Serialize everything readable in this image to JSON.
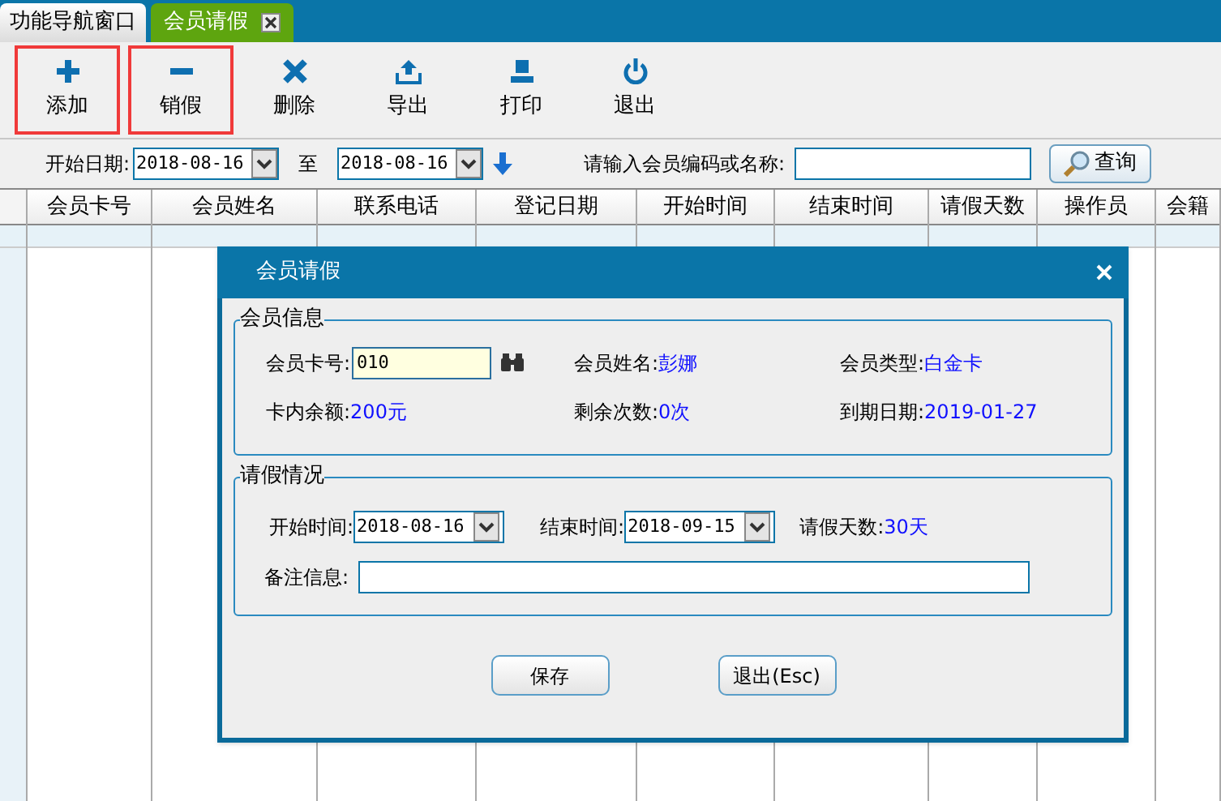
{
  "tabs": [
    {
      "label": "功能导航窗口",
      "selected": false
    },
    {
      "label": "会员请假",
      "selected": true
    }
  ],
  "toolbar": [
    {
      "label": "添加",
      "kind": "add",
      "highlighted": true
    },
    {
      "label": "销假",
      "kind": "cancel",
      "highlighted": true
    },
    {
      "label": "删除",
      "kind": "delete",
      "highlighted": false
    },
    {
      "label": "导出",
      "kind": "export",
      "highlighted": false
    },
    {
      "label": "打印",
      "kind": "print",
      "highlighted": false
    },
    {
      "label": "退出",
      "kind": "exit",
      "highlighted": false
    }
  ],
  "filter": {
    "start_label": "开始日期:",
    "start_value": "2018-08-16",
    "to_label": "至",
    "end_value": "2018-08-16",
    "search_label": "请输入会员编码或名称:",
    "search_button": "查询"
  },
  "table": {
    "columns": [
      "会员卡号",
      "会员姓名",
      "联系电话",
      "登记日期",
      "开始时间",
      "结束时间",
      "请假天数",
      "操作员",
      "会籍"
    ]
  },
  "dialog": {
    "title": "会员请假",
    "member_info": {
      "legend": "会员信息",
      "card_label": "会员卡号:",
      "card_value": "010",
      "fields": [
        {
          "label": "会员姓名:",
          "value": "彭娜"
        },
        {
          "label": "会员类型:",
          "value": "白金卡"
        },
        {
          "label": "卡内余额:",
          "value": "200元"
        },
        {
          "label": "剩余次数:",
          "value": "0次"
        },
        {
          "label": "到期日期:",
          "value": "2019-01-27"
        }
      ]
    },
    "leave_info": {
      "legend": "请假情况",
      "start_label": "开始时间:",
      "start_value": "2018-08-16",
      "end_label": "结束时间:",
      "end_value": "2018-09-15",
      "days_label": "请假天数:",
      "days_value": "30天",
      "note_label": "备注信息:"
    },
    "buttons": [
      "保存",
      "退出(Esc)"
    ]
  }
}
